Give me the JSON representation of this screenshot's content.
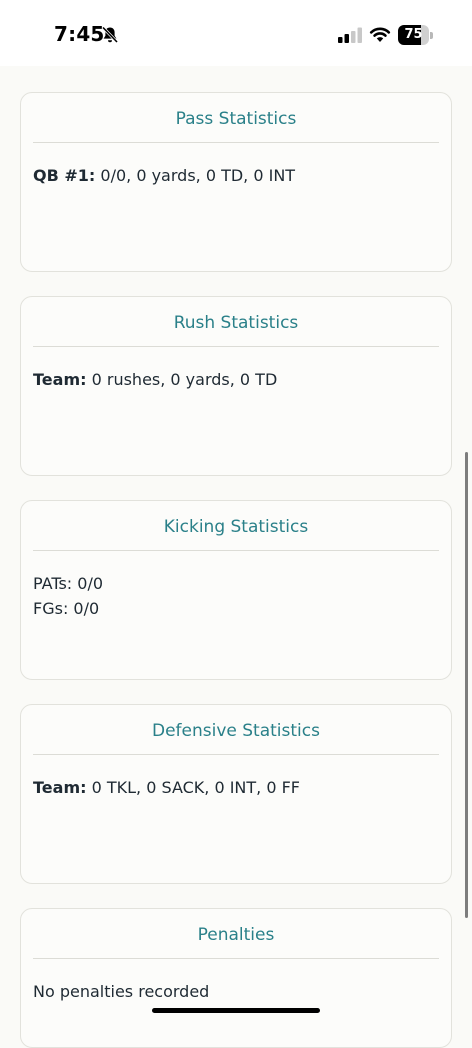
{
  "status_bar": {
    "time": "7:45",
    "battery_level": "75",
    "battery_fraction": 0.75
  },
  "cards": [
    {
      "title": "Pass Statistics",
      "lines": [
        {
          "label": "QB #1:",
          "text": " 0/0, 0 yards, 0 TD, 0 INT"
        }
      ]
    },
    {
      "title": "Rush Statistics",
      "lines": [
        {
          "label": "Team:",
          "text": " 0 rushes, 0 yards, 0 TD"
        }
      ]
    },
    {
      "title": "Kicking Statistics",
      "lines": [
        {
          "label": "",
          "text": "PATs: 0/0"
        },
        {
          "label": "",
          "text": "FGs: 0/0"
        }
      ]
    },
    {
      "title": "Defensive Statistics",
      "lines": [
        {
          "label": "Team:",
          "text": " 0 TKL, 0 SACK, 0 INT, 0 FF"
        }
      ]
    },
    {
      "title": "Penalties",
      "lines": [
        {
          "label": "",
          "text": "No penalties recorded"
        }
      ]
    }
  ],
  "colors": {
    "accent": "#2a8089",
    "background": "#fafaf7",
    "card_border": "#e2e2dc",
    "text": "#1f2a33"
  },
  "icons": {
    "bell": "bell-off-icon",
    "signal": "cellular-signal-icon",
    "wifi": "wifi-icon",
    "battery": "battery-icon"
  }
}
